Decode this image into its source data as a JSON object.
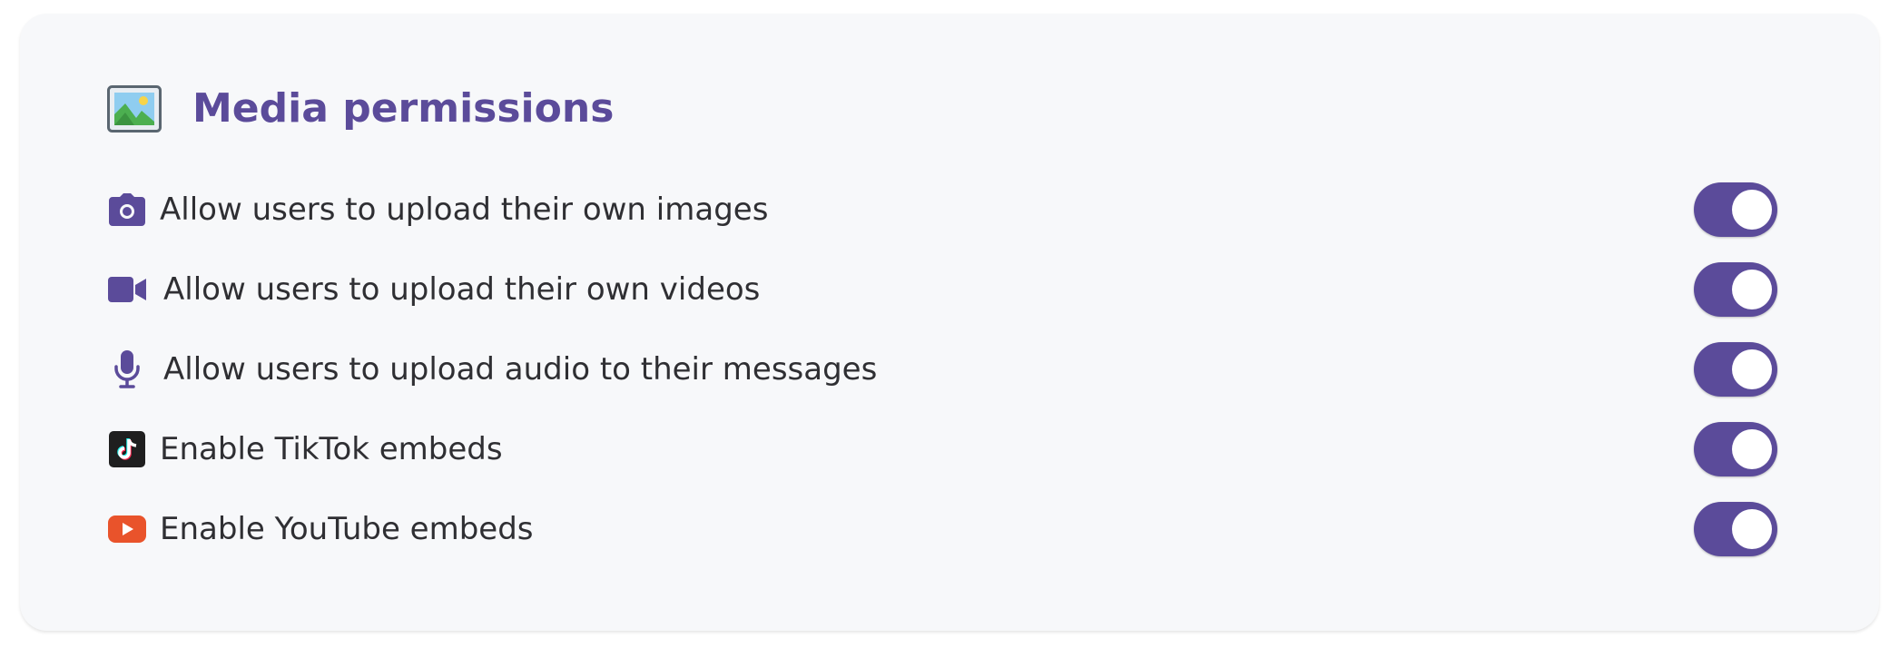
{
  "section": {
    "title": "Media permissions",
    "icon": "picture-icon",
    "title_color": "#5b4b9a"
  },
  "colors": {
    "accent": "#5b4b9a",
    "card_background": "#f7f8fa",
    "text": "#2f2f33",
    "tiktok": "#1f1f1f",
    "youtube": "#e9532b"
  },
  "permissions": [
    {
      "label": "Allow users to upload their own images",
      "icon": "camera-icon",
      "enabled": true
    },
    {
      "label": "Allow users to upload their own videos",
      "icon": "video-camera-icon",
      "enabled": true
    },
    {
      "label": "Allow users to upload audio to their messages",
      "icon": "microphone-icon",
      "enabled": true
    },
    {
      "label": "Enable TikTok embeds",
      "icon": "tiktok-icon",
      "enabled": true
    },
    {
      "label": "Enable YouTube embeds",
      "icon": "youtube-icon",
      "enabled": true
    }
  ]
}
